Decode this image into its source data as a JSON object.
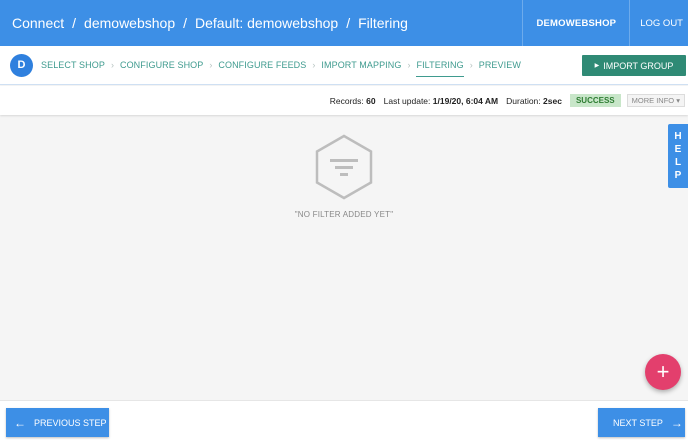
{
  "header": {
    "breadcrumb": [
      "Connect",
      "demowebshop",
      "Default: demowebshop",
      "Filtering"
    ],
    "separator": "/",
    "shop_label": "DEMOWEBSHOP",
    "logout_label": "LOG OUT"
  },
  "steps": {
    "avatar_letter": "D",
    "items": [
      "SELECT SHOP",
      "CONFIGURE SHOP",
      "CONFIGURE FEEDS",
      "IMPORT MAPPING",
      "FILTERING",
      "PREVIEW"
    ],
    "active_index": 4,
    "import_group_label": "IMPORT GROUP"
  },
  "stats": {
    "records_label": "Records:",
    "records_value": "60",
    "last_update_label": "Last update:",
    "last_update_value": "1/19/20, 6:04 AM",
    "duration_label": "Duration:",
    "duration_value": "2sec",
    "status": "SUCCESS",
    "more_info_label": "MORE INFO"
  },
  "empty_state": {
    "icon": "filter-icon",
    "text": "\"NO FILTER ADDED YET\""
  },
  "help": {
    "letters": [
      "H",
      "E",
      "L",
      "P"
    ]
  },
  "fab": {
    "label": "+"
  },
  "footer": {
    "previous_label": "PREVIOUS STEP",
    "next_label": "NEXT STEP"
  },
  "colors": {
    "header_bg": "#3d8fe6",
    "step_text": "#3f9b8f",
    "import_button": "#2f8a75",
    "success_bg": "#c8e6c9",
    "fab": "#e33f6d"
  }
}
